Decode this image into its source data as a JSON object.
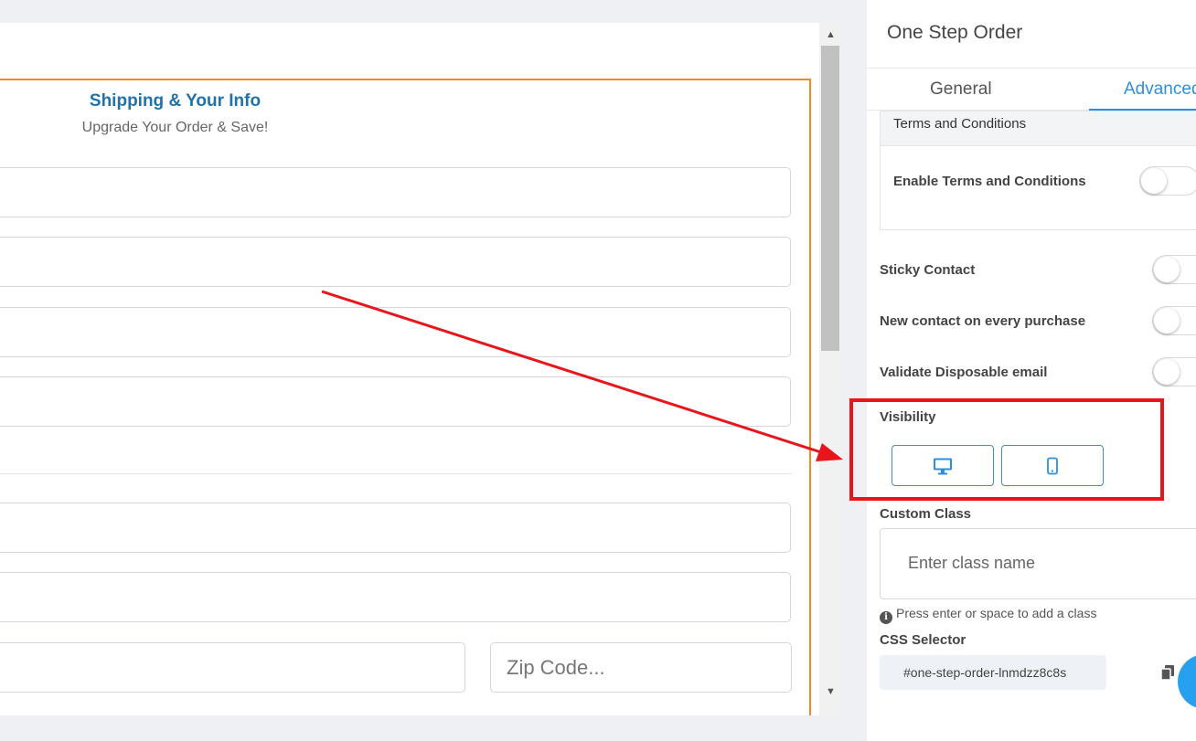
{
  "form": {
    "title": "Shipping & Your Info",
    "subtitle": "Upgrade Your Order & Save!",
    "zip_placeholder": "Zip Code..."
  },
  "panel": {
    "title": "One Step Order",
    "tabs": [
      {
        "label": "General",
        "active": false
      },
      {
        "label": "Advanced",
        "active": true
      }
    ],
    "terms_section": {
      "heading": "Terms and Conditions",
      "enable_label": "Enable Terms and Conditions",
      "enabled": false
    },
    "toggles": [
      {
        "label": "Sticky Contact",
        "enabled": false
      },
      {
        "label": "New contact on every purchase",
        "enabled": false
      },
      {
        "label": "Validate Disposable email",
        "enabled": false
      }
    ],
    "visibility": {
      "label": "Visibility",
      "options": [
        {
          "icon": "desktop-icon",
          "selected": true
        },
        {
          "icon": "mobile-icon",
          "selected": true
        }
      ]
    },
    "custom_class": {
      "label": "Custom Class",
      "placeholder": "Enter class name",
      "hint": "Press enter or space to add a class"
    },
    "css_selector": {
      "label": "CSS Selector",
      "value": "#one-step-order-lnmdzz8c8s"
    }
  },
  "colors": {
    "accent": "#2d8fe0",
    "form_border": "#f38a1c",
    "form_title": "#1f73a8",
    "annotation": "#e8161c"
  }
}
